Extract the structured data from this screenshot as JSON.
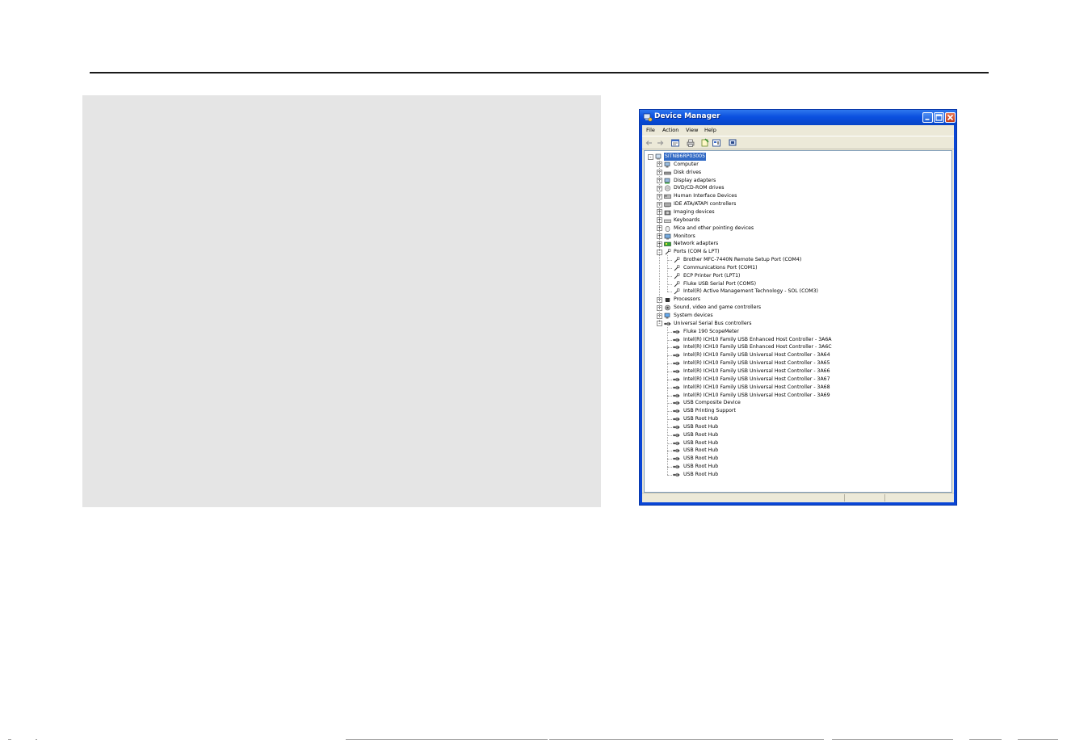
{
  "window": {
    "title": "Device Manager",
    "menu": [
      "File",
      "Action",
      "View",
      "Help"
    ],
    "toolbar_icons": [
      "back-arrow-icon",
      "forward-arrow-icon",
      "properties-icon",
      "print-icon",
      "help-icon",
      "view-icon",
      "scan-hardware-icon"
    ]
  },
  "tree": [
    {
      "label": "SITNB6RP03005",
      "level": 0,
      "expander": "-",
      "icon": "computer-root-icon",
      "selected": true
    },
    {
      "label": "Computer",
      "level": 1,
      "expander": "+",
      "icon": "computer-icon"
    },
    {
      "label": "Disk drives",
      "level": 1,
      "expander": "+",
      "icon": "disk-drive-icon"
    },
    {
      "label": "Display adapters",
      "level": 1,
      "expander": "+",
      "icon": "display-adapter-icon"
    },
    {
      "label": "DVD/CD-ROM drives",
      "level": 1,
      "expander": "+",
      "icon": "dvd-drive-icon"
    },
    {
      "label": "Human Interface Devices",
      "level": 1,
      "expander": "+",
      "icon": "hid-icon"
    },
    {
      "label": "IDE ATA/ATAPI controllers",
      "level": 1,
      "expander": "+",
      "icon": "ide-controller-icon"
    },
    {
      "label": "Imaging devices",
      "level": 1,
      "expander": "+",
      "icon": "imaging-device-icon"
    },
    {
      "label": "Keyboards",
      "level": 1,
      "expander": "+",
      "icon": "keyboard-icon"
    },
    {
      "label": "Mice and other pointing devices",
      "level": 1,
      "expander": "+",
      "icon": "mouse-icon"
    },
    {
      "label": "Monitors",
      "level": 1,
      "expander": "+",
      "icon": "monitor-icon"
    },
    {
      "label": "Network adapters",
      "level": 1,
      "expander": "+",
      "icon": "network-adapter-icon"
    },
    {
      "label": "Ports (COM & LPT)",
      "level": 1,
      "expander": "-",
      "icon": "port-icon"
    },
    {
      "label": "Brother MFC-7440N Remote Setup Port (COM4)",
      "level": 2,
      "icon": "port-icon"
    },
    {
      "label": "Communications Port (COM1)",
      "level": 2,
      "icon": "port-icon"
    },
    {
      "label": "ECP Printer Port (LPT1)",
      "level": 2,
      "icon": "port-icon"
    },
    {
      "label": "Fluke USB Serial Port (COM5)",
      "level": 2,
      "icon": "port-icon"
    },
    {
      "label": "Intel(R) Active Management Technology - SOL (COM3)",
      "level": 2,
      "icon": "port-icon"
    },
    {
      "label": "Processors",
      "level": 1,
      "expander": "+",
      "icon": "processor-icon"
    },
    {
      "label": "Sound, video and game controllers",
      "level": 1,
      "expander": "+",
      "icon": "sound-icon"
    },
    {
      "label": "System devices",
      "level": 1,
      "expander": "+",
      "icon": "system-device-icon"
    },
    {
      "label": "Universal Serial Bus controllers",
      "level": 1,
      "expander": "-",
      "icon": "usb-icon"
    },
    {
      "label": "Fluke 190 ScopeMeter",
      "level": 2,
      "icon": "usb-icon"
    },
    {
      "label": "Intel(R) ICH10 Family USB Enhanced Host Controller - 3A6A",
      "level": 2,
      "icon": "usb-icon"
    },
    {
      "label": "Intel(R) ICH10 Family USB Enhanced Host Controller - 3A6C",
      "level": 2,
      "icon": "usb-icon"
    },
    {
      "label": "Intel(R) ICH10 Family USB Universal Host Controller - 3A64",
      "level": 2,
      "icon": "usb-icon"
    },
    {
      "label": "Intel(R) ICH10 Family USB Universal Host Controller - 3A65",
      "level": 2,
      "icon": "usb-icon"
    },
    {
      "label": "Intel(R) ICH10 Family USB Universal Host Controller - 3A66",
      "level": 2,
      "icon": "usb-icon"
    },
    {
      "label": "Intel(R) ICH10 Family USB Universal Host Controller - 3A67",
      "level": 2,
      "icon": "usb-icon"
    },
    {
      "label": "Intel(R) ICH10 Family USB Universal Host Controller - 3A68",
      "level": 2,
      "icon": "usb-icon"
    },
    {
      "label": "Intel(R) ICH10 Family USB Universal Host Controller - 3A69",
      "level": 2,
      "icon": "usb-icon"
    },
    {
      "label": "USB Composite Device",
      "level": 2,
      "icon": "usb-icon"
    },
    {
      "label": "USB Printing Support",
      "level": 2,
      "icon": "usb-icon"
    },
    {
      "label": "USB Root Hub",
      "level": 2,
      "icon": "usb-icon"
    },
    {
      "label": "USB Root Hub",
      "level": 2,
      "icon": "usb-icon"
    },
    {
      "label": "USB Root Hub",
      "level": 2,
      "icon": "usb-icon"
    },
    {
      "label": "USB Root Hub",
      "level": 2,
      "icon": "usb-icon"
    },
    {
      "label": "USB Root Hub",
      "level": 2,
      "icon": "usb-icon"
    },
    {
      "label": "USB Root Hub",
      "level": 2,
      "icon": "usb-icon"
    },
    {
      "label": "USB Root Hub",
      "level": 2,
      "icon": "usb-icon"
    },
    {
      "label": "USB Root Hub",
      "level": 2,
      "icon": "usb-icon"
    }
  ],
  "colors": {
    "titlebar": "#0b50e0",
    "selection": "#316ac5",
    "panel": "#e5e5e5",
    "chrome": "#ece9d8"
  }
}
